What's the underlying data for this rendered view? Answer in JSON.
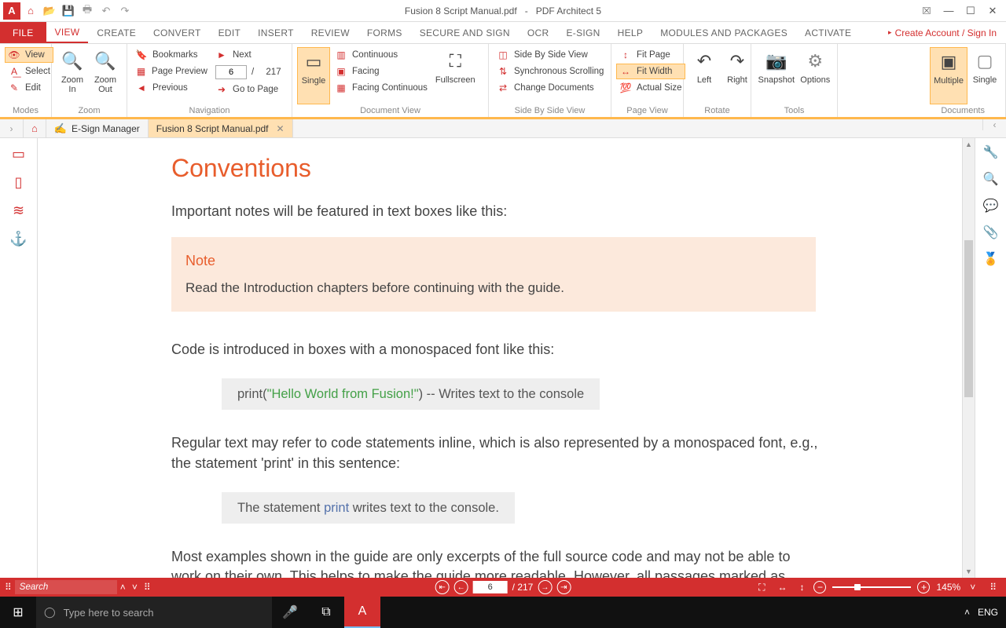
{
  "app": {
    "title_doc": "Fusion 8 Script Manual.pdf",
    "title_sep": "-",
    "title_app": "PDF Architect 5",
    "create_account": "Create Account / Sign In"
  },
  "menu": {
    "file": "FILE",
    "view": "VIEW",
    "create": "CREATE",
    "convert": "CONVERT",
    "edit": "EDIT",
    "insert": "INSERT",
    "review": "REVIEW",
    "forms": "FORMS",
    "secure": "SECURE AND SIGN",
    "ocr": "OCR",
    "esign": "E-SIGN",
    "help": "HELP",
    "modules": "MODULES AND PACKAGES",
    "activate": "ACTIVATE"
  },
  "ribbon": {
    "modes": {
      "label": "Modes",
      "view": "View",
      "select": "Select",
      "edit": "Edit"
    },
    "zoom": {
      "label": "Zoom",
      "in": "Zoom\nIn",
      "out": "Zoom\nOut"
    },
    "nav": {
      "label": "Navigation",
      "bookmarks": "Bookmarks",
      "preview": "Page Preview",
      "previous": "Previous",
      "next": "Next",
      "page_current": "6",
      "page_sep": "/",
      "page_total": "217",
      "goto": "Go to Page"
    },
    "docview": {
      "label": "Document View",
      "single": "Single",
      "continuous": "Continuous",
      "facing": "Facing",
      "facingcont": "Facing Continuous",
      "fullscreen": "Fullscreen"
    },
    "sbs": {
      "label": "Side By Side View",
      "sidebyside": "Side By Side View",
      "sync": "Synchronous Scrolling",
      "change": "Change Documents"
    },
    "pageview": {
      "label": "Page View",
      "fitpage": "Fit Page",
      "fitwidth": "Fit Width",
      "actual": "Actual Size"
    },
    "rotate": {
      "label": "Rotate",
      "left": "Left",
      "right": "Right"
    },
    "tools": {
      "label": "Tools",
      "snapshot": "Snapshot",
      "options": "Options"
    },
    "docs": {
      "label": "Documents",
      "multiple": "Multiple",
      "single": "Single"
    }
  },
  "doctabs": {
    "home": "⌂",
    "esign": "E-Sign Manager",
    "current": "Fusion 8 Script Manual.pdf"
  },
  "content": {
    "h1": "Conventions",
    "intro": "Important notes will be featured in text boxes like this:",
    "note_title": "Note",
    "note_body": "Read the Introduction chapters before continuing with the guide.",
    "code_intro": "Code is introduced in boxes with a monospaced font like this:",
    "code1_a": "print(",
    "code1_str": "\"Hello World from Fusion!\"",
    "code1_b": ")   -- Writes text to the console",
    "inline_intro": "Regular text may refer to code statements inline, which is also represented by a monospaced font, e.g., the statement 'print' in this sentence:",
    "code2_a": "The statement ",
    "code2_kw": "print",
    "code2_b": " writes text to the console.",
    "outro": "Most examples shown in the guide are only excerpts of the full source code and may not be able to work on their own. This helps to make the guide more readable. However, all passages marked as"
  },
  "status": {
    "search": "Search",
    "page": "6",
    "total": "/ 217",
    "zoom": "145%"
  },
  "taskbar": {
    "search": "Type here to search",
    "lang": "ENG"
  }
}
